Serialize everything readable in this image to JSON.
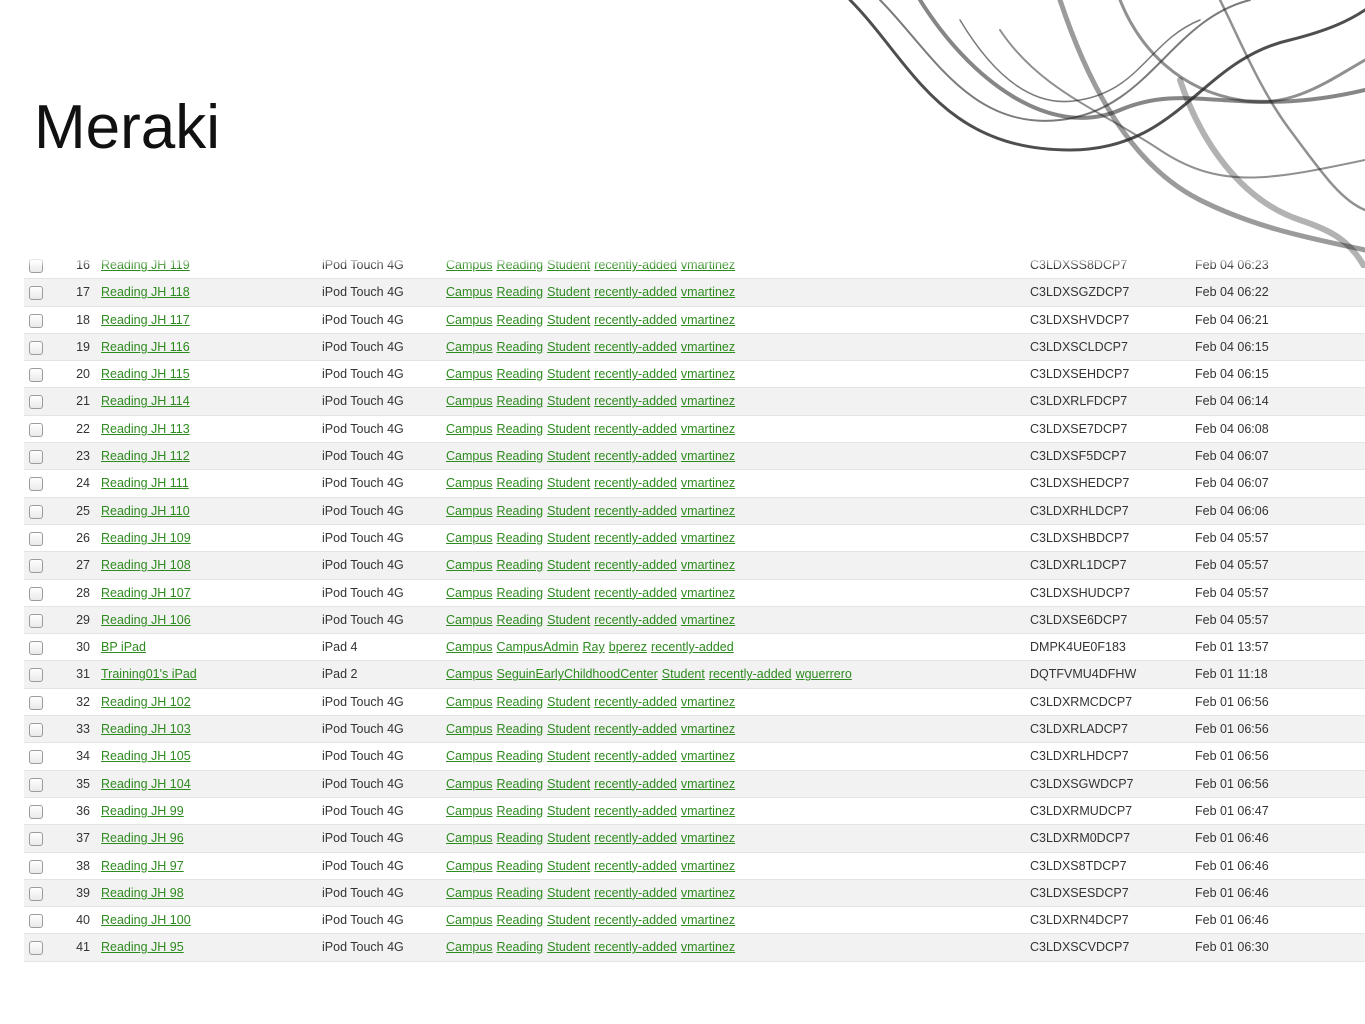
{
  "title": "Meraki",
  "colors": {
    "link": "#2e8b1f",
    "row_alt": "#f2f2f2"
  },
  "devices": [
    {
      "num": "16",
      "name": "Reading JH 119",
      "model": "iPod Touch 4G",
      "tags": [
        "Campus",
        "Reading",
        "Student",
        "recently-added",
        "vmartinez"
      ],
      "serial": "C3LDXSS8DCP7",
      "seen": "Feb 04 06:23"
    },
    {
      "num": "17",
      "name": "Reading JH 118",
      "model": "iPod Touch 4G",
      "tags": [
        "Campus",
        "Reading",
        "Student",
        "recently-added",
        "vmartinez"
      ],
      "serial": "C3LDXSGZDCP7",
      "seen": "Feb 04 06:22"
    },
    {
      "num": "18",
      "name": "Reading JH 117",
      "model": "iPod Touch 4G",
      "tags": [
        "Campus",
        "Reading",
        "Student",
        "recently-added",
        "vmartinez"
      ],
      "serial": "C3LDXSHVDCP7",
      "seen": "Feb 04 06:21"
    },
    {
      "num": "19",
      "name": "Reading JH 116",
      "model": "iPod Touch 4G",
      "tags": [
        "Campus",
        "Reading",
        "Student",
        "recently-added",
        "vmartinez"
      ],
      "serial": "C3LDXSCLDCP7",
      "seen": "Feb 04 06:15"
    },
    {
      "num": "20",
      "name": "Reading JH 115",
      "model": "iPod Touch 4G",
      "tags": [
        "Campus",
        "Reading",
        "Student",
        "recently-added",
        "vmartinez"
      ],
      "serial": "C3LDXSEHDCP7",
      "seen": "Feb 04 06:15"
    },
    {
      "num": "21",
      "name": "Reading JH 114",
      "model": "iPod Touch 4G",
      "tags": [
        "Campus",
        "Reading",
        "Student",
        "recently-added",
        "vmartinez"
      ],
      "serial": "C3LDXRLFDCP7",
      "seen": "Feb 04 06:14"
    },
    {
      "num": "22",
      "name": "Reading JH 113",
      "model": "iPod Touch 4G",
      "tags": [
        "Campus",
        "Reading",
        "Student",
        "recently-added",
        "vmartinez"
      ],
      "serial": "C3LDXSE7DCP7",
      "seen": "Feb 04 06:08"
    },
    {
      "num": "23",
      "name": "Reading JH 112",
      "model": "iPod Touch 4G",
      "tags": [
        "Campus",
        "Reading",
        "Student",
        "recently-added",
        "vmartinez"
      ],
      "serial": "C3LDXSF5DCP7",
      "seen": "Feb 04 06:07"
    },
    {
      "num": "24",
      "name": "Reading JH 111",
      "model": "iPod Touch 4G",
      "tags": [
        "Campus",
        "Reading",
        "Student",
        "recently-added",
        "vmartinez"
      ],
      "serial": "C3LDXSHEDCP7",
      "seen": "Feb 04 06:07"
    },
    {
      "num": "25",
      "name": "Reading JH 110",
      "model": "iPod Touch 4G",
      "tags": [
        "Campus",
        "Reading",
        "Student",
        "recently-added",
        "vmartinez"
      ],
      "serial": "C3LDXRHLDCP7",
      "seen": "Feb 04 06:06"
    },
    {
      "num": "26",
      "name": "Reading JH 109",
      "model": "iPod Touch 4G",
      "tags": [
        "Campus",
        "Reading",
        "Student",
        "recently-added",
        "vmartinez"
      ],
      "serial": "C3LDXSHBDCP7",
      "seen": "Feb 04 05:57"
    },
    {
      "num": "27",
      "name": "Reading JH 108",
      "model": "iPod Touch 4G",
      "tags": [
        "Campus",
        "Reading",
        "Student",
        "recently-added",
        "vmartinez"
      ],
      "serial": "C3LDXRL1DCP7",
      "seen": "Feb 04 05:57"
    },
    {
      "num": "28",
      "name": "Reading JH 107",
      "model": "iPod Touch 4G",
      "tags": [
        "Campus",
        "Reading",
        "Student",
        "recently-added",
        "vmartinez"
      ],
      "serial": "C3LDXSHUDCP7",
      "seen": "Feb 04 05:57"
    },
    {
      "num": "29",
      "name": "Reading JH 106",
      "model": "iPod Touch 4G",
      "tags": [
        "Campus",
        "Reading",
        "Student",
        "recently-added",
        "vmartinez"
      ],
      "serial": "C3LDXSE6DCP7",
      "seen": "Feb 04 05:57"
    },
    {
      "num": "30",
      "name": "BP iPad",
      "model": "iPad 4",
      "tags": [
        "Campus",
        "CampusAdmin",
        "Ray",
        "bperez",
        "recently-added"
      ],
      "serial": "DMPK4UE0F183",
      "seen": "Feb 01 13:57"
    },
    {
      "num": "31",
      "name": "Training01's iPad",
      "model": "iPad 2",
      "tags": [
        "Campus",
        "SeguinEarlyChildhoodCenter",
        "Student",
        "recently-added",
        "wguerrero"
      ],
      "serial": "DQTFVMU4DFHW",
      "seen": "Feb 01 11:18"
    },
    {
      "num": "32",
      "name": "Reading JH 102",
      "model": "iPod Touch 4G",
      "tags": [
        "Campus",
        "Reading",
        "Student",
        "recently-added",
        "vmartinez"
      ],
      "serial": "C3LDXRMCDCP7",
      "seen": "Feb 01 06:56"
    },
    {
      "num": "33",
      "name": "Reading JH 103",
      "model": "iPod Touch 4G",
      "tags": [
        "Campus",
        "Reading",
        "Student",
        "recently-added",
        "vmartinez"
      ],
      "serial": "C3LDXRLADCP7",
      "seen": "Feb 01 06:56"
    },
    {
      "num": "34",
      "name": "Reading JH 105",
      "model": "iPod Touch 4G",
      "tags": [
        "Campus",
        "Reading",
        "Student",
        "recently-added",
        "vmartinez"
      ],
      "serial": "C3LDXRLHDCP7",
      "seen": "Feb 01 06:56"
    },
    {
      "num": "35",
      "name": "Reading JH 104",
      "model": "iPod Touch 4G",
      "tags": [
        "Campus",
        "Reading",
        "Student",
        "recently-added",
        "vmartinez"
      ],
      "serial": "C3LDXSGWDCP7",
      "seen": "Feb 01 06:56"
    },
    {
      "num": "36",
      "name": "Reading JH 99",
      "model": "iPod Touch 4G",
      "tags": [
        "Campus",
        "Reading",
        "Student",
        "recently-added",
        "vmartinez"
      ],
      "serial": "C3LDXRMUDCP7",
      "seen": "Feb 01 06:47"
    },
    {
      "num": "37",
      "name": "Reading JH 96",
      "model": "iPod Touch 4G",
      "tags": [
        "Campus",
        "Reading",
        "Student",
        "recently-added",
        "vmartinez"
      ],
      "serial": "C3LDXRM0DCP7",
      "seen": "Feb 01 06:46"
    },
    {
      "num": "38",
      "name": "Reading JH 97",
      "model": "iPod Touch 4G",
      "tags": [
        "Campus",
        "Reading",
        "Student",
        "recently-added",
        "vmartinez"
      ],
      "serial": "C3LDXS8TDCP7",
      "seen": "Feb 01 06:46"
    },
    {
      "num": "39",
      "name": "Reading JH 98",
      "model": "iPod Touch 4G",
      "tags": [
        "Campus",
        "Reading",
        "Student",
        "recently-added",
        "vmartinez"
      ],
      "serial": "C3LDXSESDCP7",
      "seen": "Feb 01 06:46"
    },
    {
      "num": "40",
      "name": "Reading JH 100",
      "model": "iPod Touch 4G",
      "tags": [
        "Campus",
        "Reading",
        "Student",
        "recently-added",
        "vmartinez"
      ],
      "serial": "C3LDXRN4DCP7",
      "seen": "Feb 01 06:46"
    },
    {
      "num": "41",
      "name": "Reading JH 95",
      "model": "iPod Touch 4G",
      "tags": [
        "Campus",
        "Reading",
        "Student",
        "recently-added",
        "vmartinez"
      ],
      "serial": "C3LDXSCVDCP7",
      "seen": "Feb 01 06:30"
    }
  ]
}
